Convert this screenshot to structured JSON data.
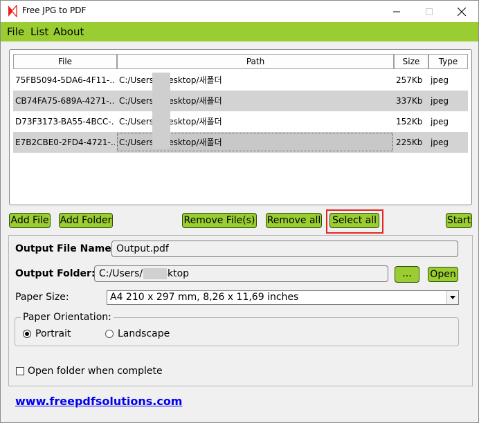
{
  "window": {
    "title": "Free JPG to PDF"
  },
  "menu": {
    "file": "File",
    "list": "List",
    "about": "About"
  },
  "table": {
    "columns": [
      "File",
      "Path",
      "Size",
      "Type"
    ],
    "rows": [
      {
        "file": "75FB5094-5DA6-4F11-…",
        "path": "C:/Users/      /Desktop/새폴더",
        "size": "257Kb",
        "type": "jpeg"
      },
      {
        "file": "CB74FA75-689A-4271-…",
        "path": "C:/Users/      /Desktop/새폴더",
        "size": "337Kb",
        "type": "jpeg"
      },
      {
        "file": "D73F3173-BA55-4BCC-…",
        "path": "C:/Users/      /Desktop/새폴더",
        "size": "152Kb",
        "type": "jpeg"
      },
      {
        "file": "E7B2CBE0-2FD4-4721-…",
        "path": "C:/Users/      /Desktop/새폴더",
        "size": "225Kb",
        "type": "jpeg"
      }
    ]
  },
  "buttons": {
    "add_file": "Add File",
    "add_folder": "Add Folder",
    "remove_files": "Remove File(s)",
    "remove_all": "Remove all",
    "select_all": "Select all",
    "start": "Start",
    "browse": "...",
    "open": "Open"
  },
  "settings": {
    "output_file_name_label": "Output File Name:",
    "output_file_name_value": "Output.pdf",
    "output_folder_label": "Output Folder:",
    "output_folder_value": "C:/Users/         /Desktop",
    "paper_size_label": "Paper Size:",
    "paper_size_value": "A4 210 x 297 mm, 8,26 x 11,69 inches",
    "orientation_label": "Paper Orientation:",
    "portrait": "Portrait",
    "landscape": "Landscape",
    "orientation_selected": "Portrait",
    "open_folder_label": "Open folder when complete",
    "open_folder_checked": false
  },
  "footer": {
    "link": "www.freepdfsolutions.com"
  },
  "colors": {
    "accent": "#9acd32",
    "highlight": "#e8231e",
    "link": "#0000ee"
  }
}
